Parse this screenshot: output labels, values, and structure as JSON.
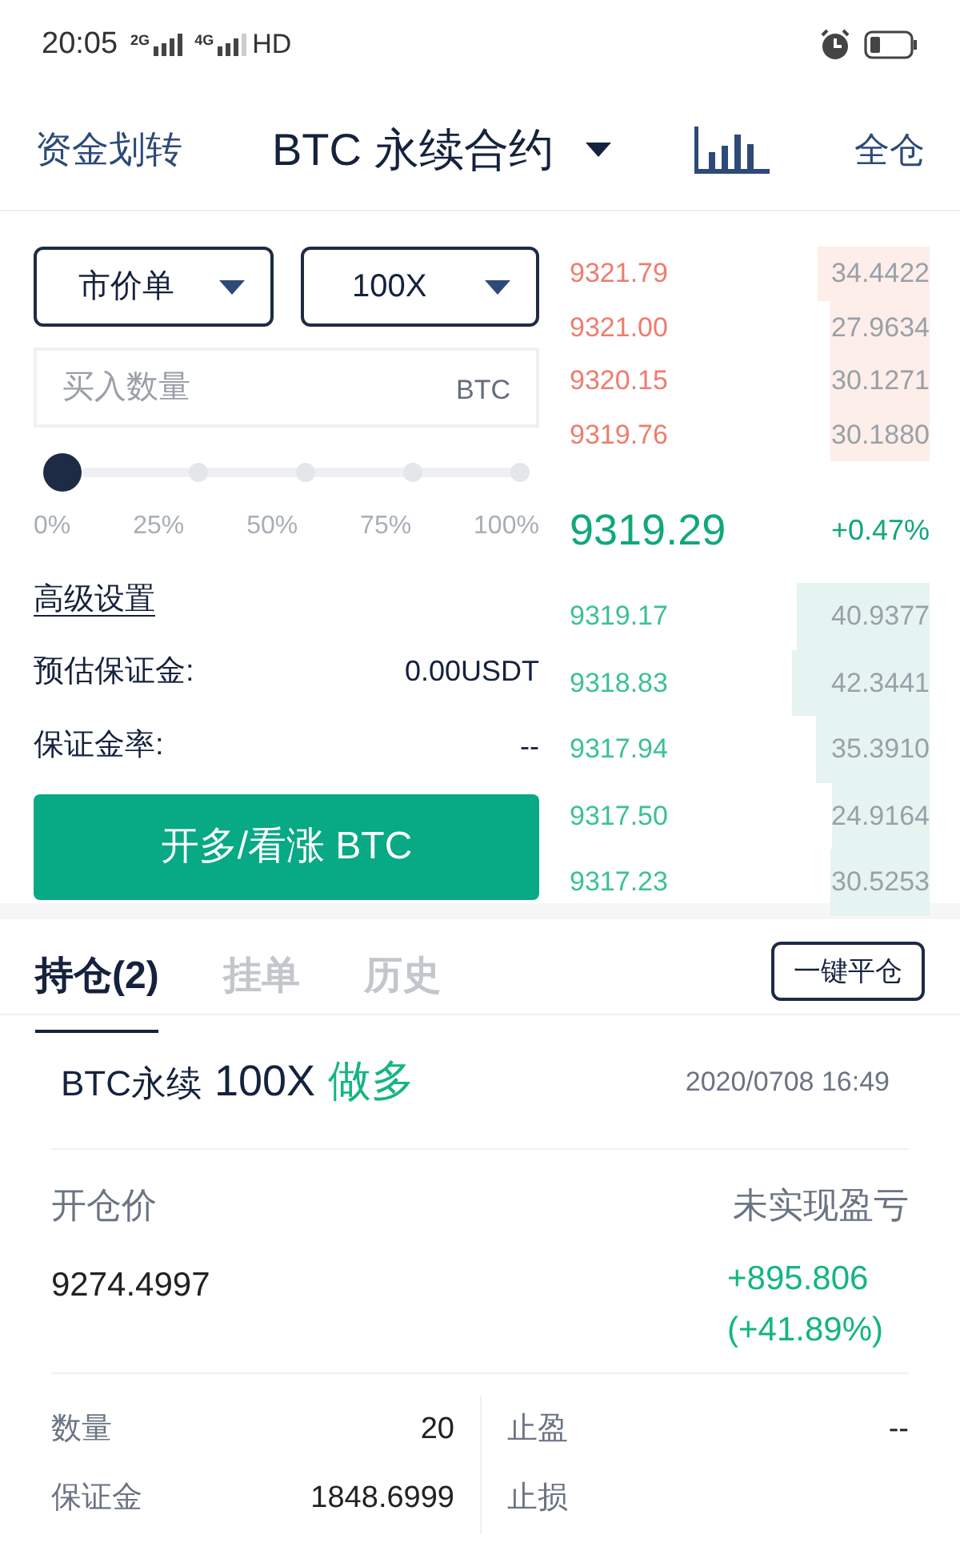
{
  "status_bar": {
    "time": "20:05",
    "network_1": "2G",
    "network_2": "4G",
    "hd": "HD"
  },
  "header": {
    "left_link": "资金划转",
    "title": "BTC 永续合约",
    "right_link": "全仓"
  },
  "order_form": {
    "order_type": "市价单",
    "leverage": "100X",
    "amount_field": {
      "placeholder": "买入数量",
      "unit": "BTC"
    },
    "slider": {
      "marks": [
        "0%",
        "25%",
        "50%",
        "75%",
        "100%"
      ]
    },
    "advanced_link": "高级设置",
    "info": [
      {
        "label": "预估保证金:",
        "value": "0.00USDT"
      },
      {
        "label": "保证金率:",
        "value": "--"
      }
    ],
    "submit_button": "开多/看涨 BTC"
  },
  "order_book": {
    "asks": [
      {
        "price": "9321.79",
        "amount": "34.4422"
      },
      {
        "price": "9321.00",
        "amount": "27.9634"
      },
      {
        "price": "9320.15",
        "amount": "30.1271"
      },
      {
        "price": "9319.76",
        "amount": "30.1880"
      }
    ],
    "last_price": "9319.29",
    "change": "+0.47%",
    "bids": [
      {
        "price": "9319.17",
        "amount": "40.9377"
      },
      {
        "price": "9318.83",
        "amount": "42.3441"
      },
      {
        "price": "9317.94",
        "amount": "35.3910"
      },
      {
        "price": "9317.50",
        "amount": "24.9164"
      },
      {
        "price": "9317.23",
        "amount": "30.5253"
      }
    ]
  },
  "tabs": [
    {
      "label": "持仓(2)",
      "selected": true
    },
    {
      "label": "挂单",
      "selected": false
    },
    {
      "label": "历史",
      "selected": false
    }
  ],
  "close_all_button": "一键平仓",
  "position": {
    "symbol": "BTC永续",
    "leverage": "100X",
    "side": "做多",
    "time": "2020/0708 16:49",
    "open_price_label": "开仓价",
    "open_price": "9274.4997",
    "pnl_label": "未实现盈亏",
    "pnl": "+895.806",
    "pnl_percent": "(+41.89%)",
    "details": [
      {
        "label": "数量",
        "value": "20"
      },
      {
        "label": "止盈",
        "value": "--"
      },
      {
        "label": "保证金",
        "value": "1848.6999"
      },
      {
        "label": "止损"
      }
    ]
  }
}
